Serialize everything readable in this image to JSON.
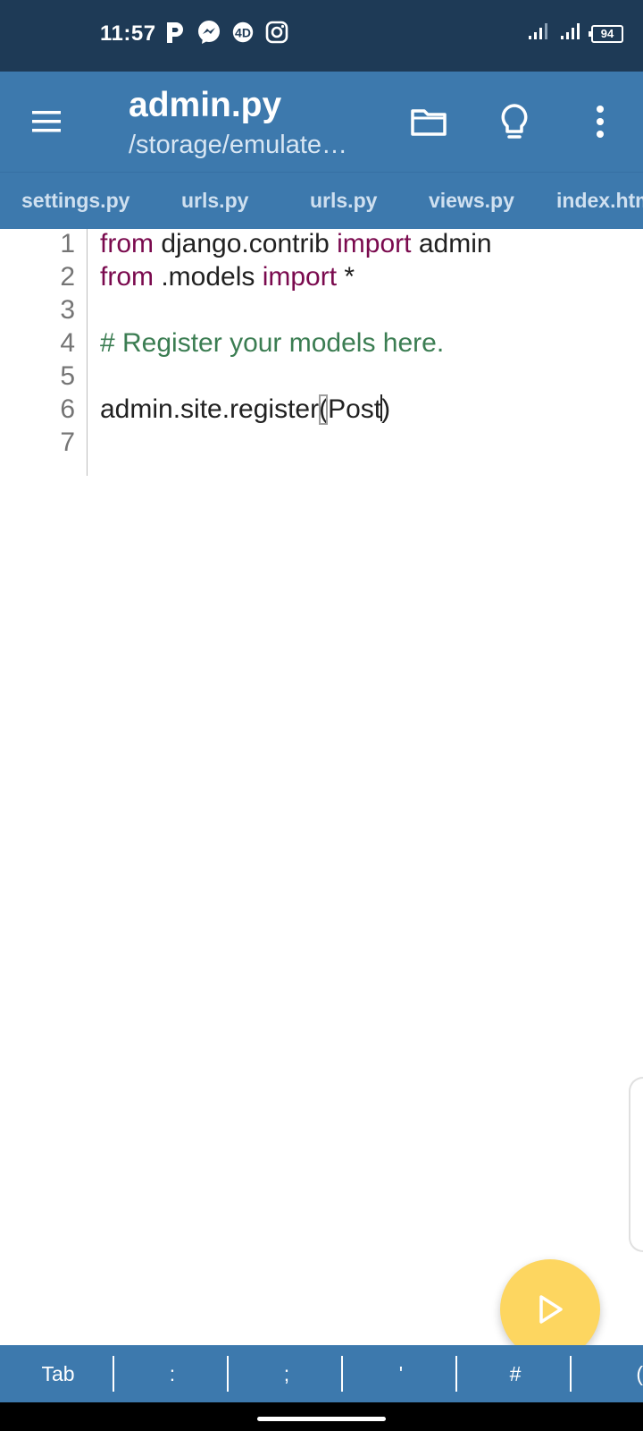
{
  "status_bar": {
    "time": "11:57",
    "battery": "94",
    "icons": [
      "parking-icon",
      "messenger-icon",
      "4d-icon",
      "instagram-icon",
      "signal-icon",
      "signal-icon",
      "battery-icon"
    ]
  },
  "toolbar": {
    "title": "admin.py",
    "subtitle": "/storage/emulate…"
  },
  "tabs": [
    {
      "label": "settings.py"
    },
    {
      "label": "urls.py"
    },
    {
      "label": "urls.py"
    },
    {
      "label": "views.py"
    },
    {
      "label": "index.htm"
    }
  ],
  "editor": {
    "line_numbers": [
      "1",
      "2",
      "3",
      "4",
      "5",
      "6",
      "7"
    ],
    "lines": {
      "l1": {
        "kw1": "from",
        "t1": " django.contrib ",
        "kw2": "import",
        "t2": " admin"
      },
      "l2": {
        "kw1": "from",
        "t1": " .models ",
        "kw2": "import",
        "t2": " *"
      },
      "l4": {
        "comment": "# Register your models here."
      },
      "l6": {
        "t1": "admin.site.register",
        "open": "(",
        "t2": "Post",
        "close": ")"
      }
    }
  },
  "symbol_bar": {
    "keys": [
      "Tab",
      ":",
      ";",
      "'",
      "#",
      "("
    ]
  },
  "colors": {
    "status_bar": "#1e3a56",
    "toolbar": "#3d79ad",
    "keyword": "#7a0a4e",
    "comment": "#3b7d52",
    "fab": "#fdd660"
  }
}
